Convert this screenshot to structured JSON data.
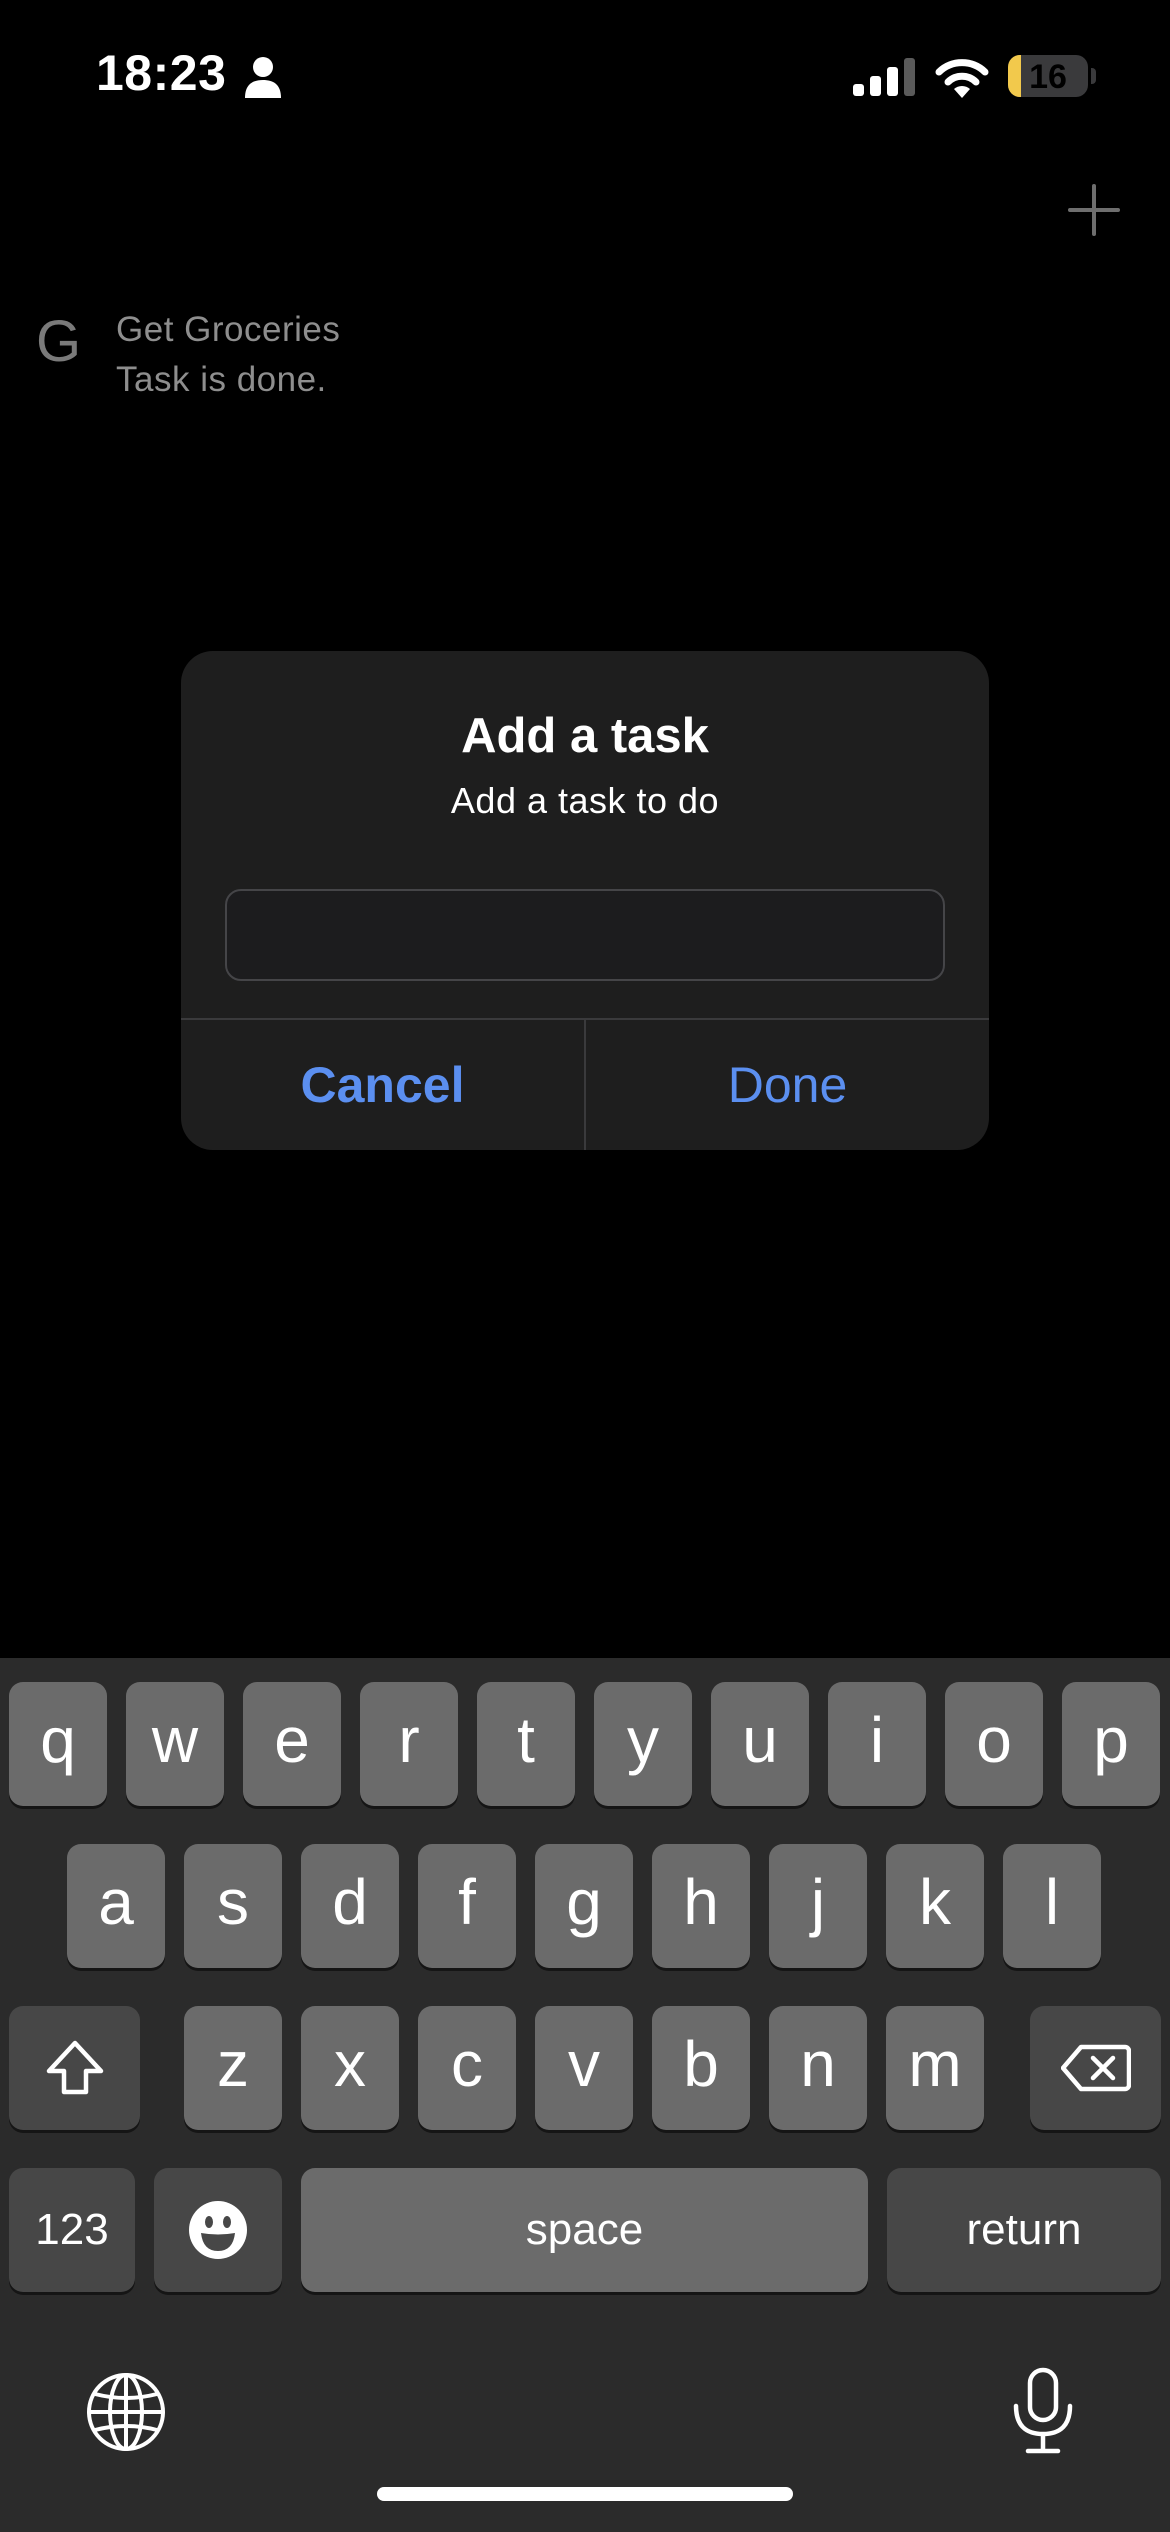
{
  "status_bar": {
    "time": "18:23",
    "battery_level": "16",
    "battery_fraction": 0.16,
    "icons": [
      "person-icon",
      "signal-icon",
      "wifi-icon",
      "battery-icon"
    ]
  },
  "header": {
    "add_icon": "plus-icon"
  },
  "tasks": [
    {
      "initial": "G",
      "title": "Get Groceries",
      "subtitle": "Task is done."
    }
  ],
  "alert": {
    "title": "Add a task",
    "message": "Add a task to do",
    "input_value": "",
    "cancel_label": "Cancel",
    "done_label": "Done"
  },
  "keyboard": {
    "row1": [
      "q",
      "w",
      "e",
      "r",
      "t",
      "y",
      "u",
      "i",
      "o",
      "p"
    ],
    "row2": [
      "a",
      "s",
      "d",
      "f",
      "g",
      "h",
      "j",
      "k",
      "l"
    ],
    "row3": [
      "z",
      "x",
      "c",
      "v",
      "b",
      "n",
      "m"
    ],
    "numbers_label": "123",
    "space_label": "space",
    "return_label": "return",
    "icons": [
      "shift-icon",
      "delete-icon",
      "emoji-icon",
      "globe-icon",
      "mic-icon"
    ]
  },
  "colors": {
    "accent": "#5b8ff0",
    "alert_bg": "#1e1e1e",
    "key_bg": "#6b6b6b",
    "func_key_bg": "#474747",
    "keyboard_bg": "#2b2b2b",
    "battery_fill": "#f2c94c"
  }
}
